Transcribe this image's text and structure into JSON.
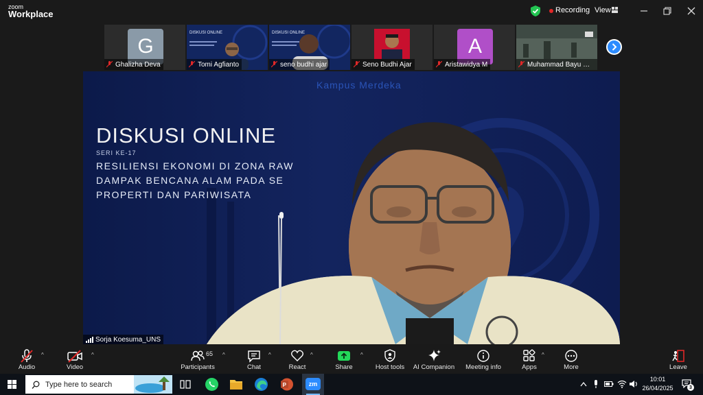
{
  "app": {
    "brand_small": "zoom",
    "brand_big": "Workplace"
  },
  "titlebar": {
    "recording_label": "Recording",
    "view_label": "View"
  },
  "thumbnails": [
    {
      "name": "Ghalizha Deva",
      "avatar_letter": "G",
      "avatar_color": "#8a9aa8",
      "muted": true
    },
    {
      "name": "Tomi Agfianto",
      "muted": true
    },
    {
      "name": "seno budhi ajar",
      "muted": true
    },
    {
      "name": "Seno Budhi Ajar",
      "muted": true
    },
    {
      "name": "Aristawidya M",
      "avatar_letter": "A",
      "avatar_color": "#b04fc8",
      "muted": true
    },
    {
      "name": "Muhammad Bayu Ha...",
      "muted": true
    }
  ],
  "thumb_texts": {
    "diskusi_small": "DISKUSI ONLINE"
  },
  "slide": {
    "title": "DISKUSI ONLINE",
    "series": "SERI KE-17",
    "line1": "RESILIENSI EKONOMI DI ZONA RAW",
    "line2": "DAMPAK BENCANA ALAM PADA SE",
    "line3": "PROPERTI DAN PARIWISATA",
    "watermark": "Kampus Merdeka"
  },
  "speaker": {
    "name": "Sorja Koesuma_UNS"
  },
  "toolbar": {
    "audio": "Audio",
    "video": "Video",
    "participants": "Participants",
    "participants_count": "65",
    "chat": "Chat",
    "react": "React",
    "share": "Share",
    "host_tools": "Host tools",
    "ai_companion": "AI Companion",
    "meeting_info": "Meeting info",
    "apps": "Apps",
    "more": "More",
    "leave": "Leave"
  },
  "taskbar": {
    "search_placeholder": "Type here to search",
    "time": "10:01",
    "date": "26/04/2025",
    "notification_count": "3",
    "zoom_icon_text": "zm"
  },
  "colors": {
    "accent": "#2d8cff",
    "recording": "#e02828",
    "share_green": "#23d959",
    "leave_red": "#e02828"
  }
}
